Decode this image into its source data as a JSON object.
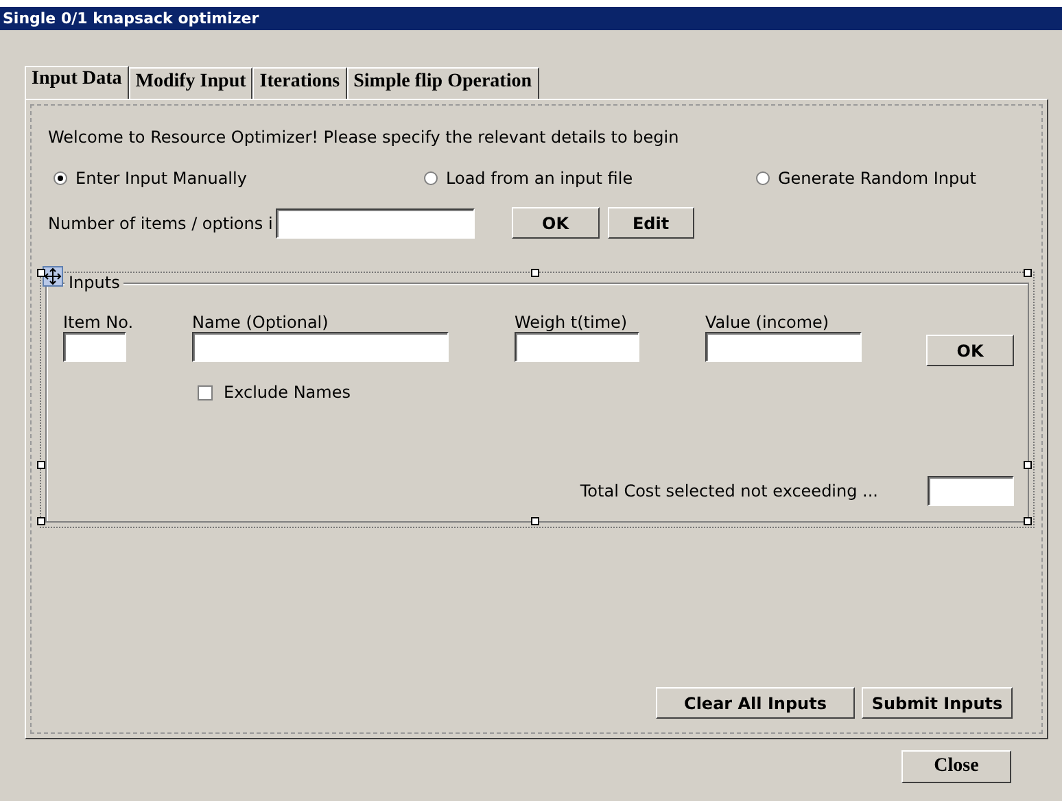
{
  "window": {
    "title": "Single 0/1 knapsack optimizer"
  },
  "tabs": [
    {
      "label": "Input Data",
      "selected": true
    },
    {
      "label": "Modify Input",
      "selected": false
    },
    {
      "label": "Iterations",
      "selected": false
    },
    {
      "label": "Simple flip Operation",
      "selected": false
    }
  ],
  "welcome": "Welcome to Resource Optimizer! Please specify the relevant details to begin",
  "modes": [
    {
      "label": "Enter Input Manually",
      "selected": true
    },
    {
      "label": "Load from an input file",
      "selected": false
    },
    {
      "label": "Generate Random Input",
      "selected": false
    }
  ],
  "item_count": {
    "label": "Number of items / options i",
    "buttons": [
      "OK",
      "Edit"
    ]
  },
  "inputs_group": {
    "title": "Inputs",
    "columns": [
      {
        "label": "Item No."
      },
      {
        "label": "Name (Optional)"
      },
      {
        "label": "Weigh t(time)"
      },
      {
        "label": "Value (income)"
      }
    ],
    "ok_button": "OK",
    "exclude_names": {
      "label": "Exclude Names",
      "checked": false
    },
    "total_cost": {
      "label": "Total Cost selected not exceeding ..."
    }
  },
  "buttons": [
    "Clear All Inputs",
    "Submit Inputs"
  ],
  "close_button": "Close"
}
